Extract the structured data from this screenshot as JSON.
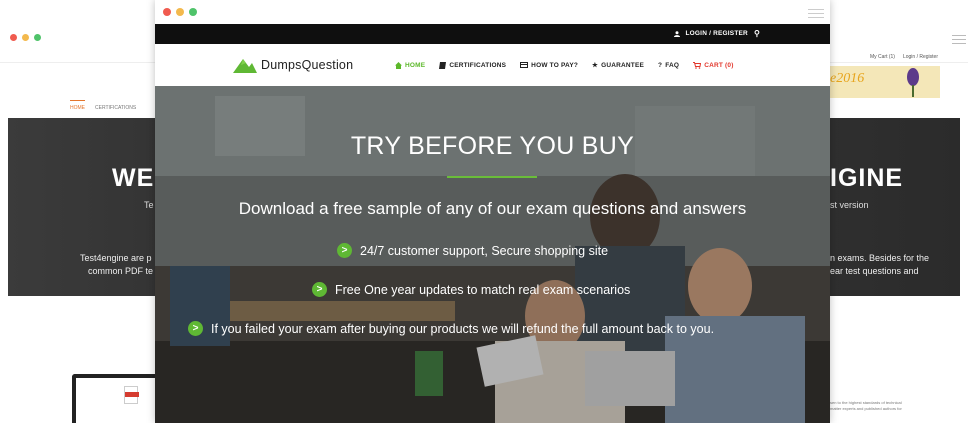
{
  "front_window": {
    "topbar": {
      "login_label": "LOGIN / REGISTER"
    },
    "brand": {
      "name": "DumpsQuestion"
    },
    "nav": [
      {
        "label": "HOME",
        "icon": "home-icon"
      },
      {
        "label": "CERTIFICATIONS",
        "icon": "book-icon"
      },
      {
        "label": "HOW TO PAY?",
        "icon": "card-icon"
      },
      {
        "label": "GUARANTEE",
        "icon": "star-icon"
      },
      {
        "label": "FAQ",
        "icon": "question-icon"
      },
      {
        "label": "CART (0)",
        "icon": "cart-icon"
      }
    ],
    "hero": {
      "title": "TRY BEFORE YOU BUY",
      "subtitle": "Download a free sample of any of our exam questions and answers",
      "bullets": [
        "24/7 customer support, Secure shopping site",
        "Free One year updates to match real exam scenarios",
        "If you failed your exam after buying our products we will refund the full amount back to you."
      ]
    }
  },
  "back_window": {
    "nav": {
      "home": "HOME",
      "certifications": "CERTIFICATIONS"
    },
    "top_links": {
      "cart": "My Cart (1)",
      "login": "Login / Register"
    },
    "year_banner": "e2016",
    "hero": {
      "title_left": "WE",
      "title_right": "IGINE",
      "sub_left": "Te",
      "sub_right": "st version",
      "para_left_1": "Test4engine are p",
      "para_left_2": "common PDF te",
      "para_right_1": "n exams. Besides for the",
      "para_right_2": "ear test questions and"
    },
    "small_text_1": "sen to the highest standards of technical",
    "small_text_2": "matter experts and published authors for"
  },
  "colors": {
    "accent_green": "#5fb834",
    "cart_red": "#e2372c",
    "topbar": "#0f0f0f"
  }
}
